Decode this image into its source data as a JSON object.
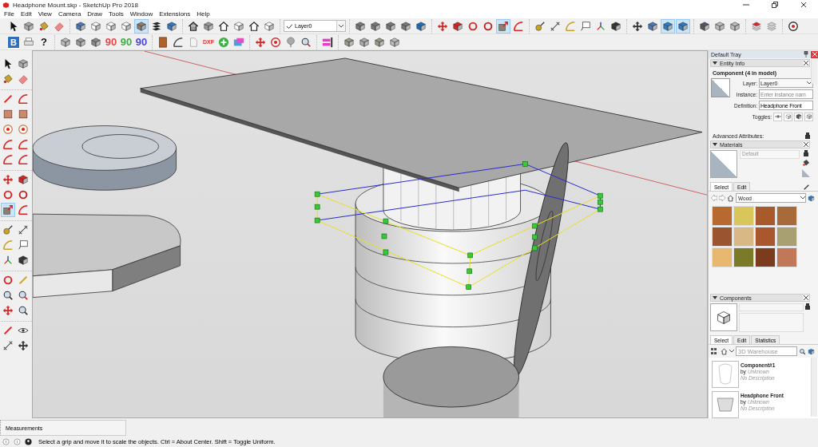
{
  "window": {
    "title": "Headphone Mount.skp - SketchUp Pro 2018"
  },
  "menu": [
    "File",
    "Edit",
    "View",
    "Camera",
    "Draw",
    "Tools",
    "Window",
    "Extensions",
    "Help"
  ],
  "toolbar_1": [
    [
      {
        "kind": "icon",
        "selected": false
      },
      {
        "kind": "icon",
        "selected": false
      },
      {
        "kind": "icon",
        "selected": false
      },
      {
        "kind": "icon",
        "selected": false
      }
    ],
    [
      {
        "kind": "icon",
        "selected": false
      },
      {
        "kind": "icon",
        "selected": false
      },
      {
        "kind": "icon",
        "selected": false
      },
      {
        "kind": "icon",
        "selected": false
      },
      {
        "kind": "icon",
        "selected": true
      },
      {
        "kind": "icon",
        "selected": false
      },
      {
        "kind": "icon",
        "selected": false
      }
    ],
    [
      {
        "kind": "icon",
        "selected": false
      },
      {
        "kind": "icon",
        "selected": false
      },
      {
        "kind": "icon",
        "selected": false
      },
      {
        "kind": "icon",
        "selected": false
      },
      {
        "kind": "icon",
        "selected": false
      },
      {
        "kind": "icon",
        "selected": false
      }
    ],
    [
      {
        "kind": "dropdown",
        "value": "Layer0"
      }
    ],
    [
      {
        "kind": "icon",
        "selected": false
      },
      {
        "kind": "icon",
        "selected": false
      },
      {
        "kind": "icon",
        "selected": false
      },
      {
        "kind": "icon",
        "selected": false
      },
      {
        "kind": "icon",
        "selected": false
      }
    ],
    [
      {
        "kind": "icon",
        "selected": false
      },
      {
        "kind": "icon",
        "selected": false
      },
      {
        "kind": "icon",
        "selected": false
      },
      {
        "kind": "icon",
        "selected": false
      },
      {
        "kind": "icon",
        "selected": true
      },
      {
        "kind": "icon",
        "selected": false
      }
    ],
    [
      {
        "kind": "icon",
        "selected": false
      },
      {
        "kind": "icon",
        "selected": false
      },
      {
        "kind": "icon",
        "selected": false
      },
      {
        "kind": "icon",
        "selected": false
      },
      {
        "kind": "icon",
        "selected": false
      },
      {
        "kind": "icon",
        "selected": false
      }
    ],
    [
      {
        "kind": "icon",
        "selected": false
      },
      {
        "kind": "icon",
        "selected": false
      },
      {
        "kind": "icon",
        "selected": true
      },
      {
        "kind": "icon",
        "selected": true
      }
    ],
    [
      {
        "kind": "icon",
        "selected": false
      },
      {
        "kind": "icon",
        "selected": false
      },
      {
        "kind": "icon",
        "selected": false
      }
    ],
    [
      {
        "kind": "icon",
        "selected": false
      },
      {
        "kind": "icon",
        "selected": false
      }
    ],
    [
      {
        "kind": "icon",
        "selected": false
      }
    ]
  ],
  "toolbar_2": [
    [
      {
        "kind": "badge",
        "text": "B"
      },
      {
        "kind": "icon",
        "selected": false
      },
      {
        "kind": "text",
        "text": "?",
        "color": "#111111"
      }
    ],
    [
      {
        "kind": "icon",
        "selected": false
      },
      {
        "kind": "icon",
        "selected": false
      },
      {
        "kind": "icon",
        "selected": false
      },
      {
        "kind": "text",
        "text": "90",
        "color": "#e8474a"
      },
      {
        "kind": "text",
        "text": "90",
        "color": "#3cb043"
      },
      {
        "kind": "text",
        "text": "90",
        "color": "#4a4ad8"
      }
    ],
    [
      {
        "kind": "icon",
        "selected": false
      },
      {
        "kind": "icon",
        "selected": false
      },
      {
        "kind": "icon",
        "selected": false
      },
      {
        "kind": "text",
        "text": "DXF",
        "color": "#e03030"
      },
      {
        "kind": "icon",
        "selected": false
      },
      {
        "kind": "icon",
        "selected": false
      }
    ],
    [
      {
        "kind": "icon",
        "selected": false
      },
      {
        "kind": "icon",
        "selected": false
      },
      {
        "kind": "icon",
        "selected": false
      },
      {
        "kind": "icon",
        "selected": false
      }
    ],
    [
      {
        "kind": "icon",
        "selected": false
      }
    ],
    [
      {
        "kind": "icon",
        "selected": false
      },
      {
        "kind": "icon",
        "selected": false
      },
      {
        "kind": "icon",
        "selected": false
      },
      {
        "kind": "icon",
        "selected": false
      }
    ]
  ],
  "left_toolbar": [
    [
      {
        "selected": false
      },
      {
        "selected": false
      },
      {
        "selected": false
      },
      {
        "selected": false
      }
    ],
    [
      {
        "selected": false
      },
      {
        "selected": false
      },
      {
        "selected": false
      },
      {
        "selected": false
      },
      {
        "selected": false
      },
      {
        "selected": false
      },
      {
        "selected": false
      },
      {
        "selected": false
      },
      {
        "selected": false
      },
      {
        "selected": false
      }
    ],
    [
      {
        "selected": false
      },
      {
        "selected": false
      },
      {
        "selected": false
      },
      {
        "selected": false
      },
      {
        "selected": true
      },
      {
        "selected": false
      }
    ],
    [
      {
        "selected": false
      },
      {
        "selected": false
      },
      {
        "selected": false
      },
      {
        "selected": false
      },
      {
        "selected": false
      },
      {
        "selected": false
      }
    ],
    [
      {
        "selected": false
      },
      {
        "selected": false
      },
      {
        "selected": false
      },
      {
        "selected": false
      },
      {
        "selected": false
      },
      {
        "selected": false
      }
    ],
    [
      {
        "selected": false
      },
      {
        "selected": false
      },
      {
        "selected": false
      },
      {
        "selected": false
      }
    ]
  ],
  "tray": {
    "title": "Default Tray",
    "entity_info": {
      "title": "Entity Info",
      "expanded": true,
      "heading": "Component (4 in model)",
      "fields": [
        {
          "label": "Layer:",
          "kind": "select",
          "value": "Layer0"
        },
        {
          "label": "Instance:",
          "kind": "input",
          "placeholder": "Enter instance nam"
        },
        {
          "label": "Definition:",
          "kind": "input",
          "value": "Headphone Front"
        }
      ],
      "toggles_label": "Toggles:",
      "advanced_label": "Advanced Attributes:"
    },
    "materials": {
      "title": "Materials",
      "expanded": true,
      "name": "Default",
      "tabs": [
        {
          "label": "Select",
          "selected": true
        },
        {
          "label": "Edit",
          "selected": false
        }
      ],
      "library": "Wood",
      "swatches": [
        {
          "color": "#b8692f"
        },
        {
          "color": "#d9c65a"
        },
        {
          "color": "#a85a2a"
        },
        {
          "color": "#a86a3a"
        },
        {
          "color": "#9a5530"
        },
        {
          "color": "#d8b884"
        },
        {
          "color": "#a8582c"
        },
        {
          "color": "#a8a070"
        },
        {
          "color": "#e8b870"
        },
        {
          "color": "#7a7a28"
        },
        {
          "color": "#7a3c1c"
        },
        {
          "color": "#c07858"
        }
      ]
    },
    "components": {
      "title": "Components",
      "expanded": true,
      "tabs": [
        {
          "label": "Select",
          "selected": true
        },
        {
          "label": "Edit",
          "selected": false
        },
        {
          "label": "Statistics",
          "selected": false
        }
      ],
      "search": {
        "placeholder": "3D Warehouse"
      },
      "items": [
        {
          "name": "Component#1",
          "by": "by",
          "author": "Unknown",
          "description": "No Description"
        },
        {
          "name": "Headphone Front",
          "by": "by",
          "author": "Unknown",
          "description": "No Description"
        }
      ]
    }
  },
  "measurements": {
    "label": "Measurements"
  },
  "status_bar": {
    "message": "Select a grip and move it to scale the objects. Ctrl = About Center. Shift = Toggle Uniform."
  }
}
